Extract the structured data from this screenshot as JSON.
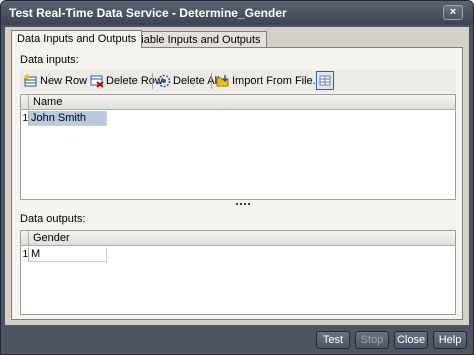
{
  "window": {
    "title": "Test Real-Time Data Service - Determine_Gender",
    "close_glyph": "×"
  },
  "tabs": [
    {
      "label": "Data Inputs and Outputs",
      "active": true
    },
    {
      "label": "Variable Inputs and Outputs",
      "active": false
    }
  ],
  "inputs": {
    "label": "Data inputs:",
    "toolbar": {
      "new_row": "New Row",
      "delete_row": "Delete Row",
      "delete_all": "Delete All",
      "import": "Import From File...",
      "grid_toggle_icon": "grid-view-icon"
    },
    "column": "Name",
    "rows": [
      {
        "num": "1",
        "value": "John Smith"
      }
    ]
  },
  "splitter_glyph": "....",
  "outputs": {
    "label": "Data outputs:",
    "column": "Gender",
    "rows": [
      {
        "num": "1",
        "value": "M"
      }
    ]
  },
  "buttons": {
    "test": "Test",
    "stop": "Stop",
    "close": "Close",
    "help": "Help"
  },
  "colors": {
    "chrome": "#4b5563",
    "client": "#d4d0c8",
    "selection": "#b8c9e3"
  }
}
